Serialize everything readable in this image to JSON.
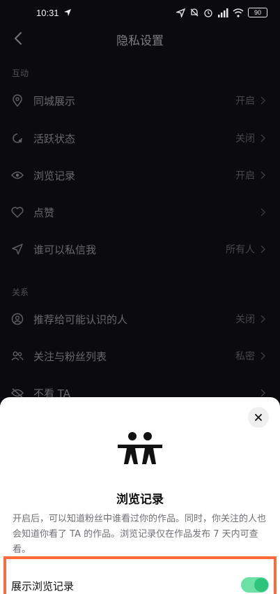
{
  "status_bar": {
    "time": "10:31",
    "battery": "90"
  },
  "nav": {
    "title": "隐私设置"
  },
  "sections": [
    {
      "label": "互动"
    },
    {
      "label": "关系"
    }
  ],
  "rows": [
    {
      "label": "同城展示",
      "value": "开启",
      "icon": "location-pin-icon"
    },
    {
      "label": "活跃状态",
      "value": "关闭",
      "icon": "activity-status-icon"
    },
    {
      "label": "浏览记录",
      "value": "开启",
      "icon": "eye-icon"
    },
    {
      "label": "点赞",
      "value": "",
      "icon": "heart-icon"
    },
    {
      "label": "谁可以私信我",
      "value": "所有人",
      "icon": "send-icon"
    },
    {
      "label": "推荐给可能认识的人",
      "value": "关闭",
      "icon": "person-circle-icon"
    },
    {
      "label": "关注与粉丝列表",
      "value": "私密",
      "icon": "two-persons-icon"
    },
    {
      "label": "不看 TA",
      "value": "",
      "icon": "eye-slash-icon"
    }
  ],
  "sheet": {
    "title": "浏览记录",
    "description": "开启后，可以知道粉丝中谁看过你的作品。同时，你关注的人也会知道你看了 TA 的作品。浏览记录仅在作品发布 7 天内可查看。",
    "toggle_label": "展示浏览记录",
    "toggle_on": true
  },
  "colors": {
    "accent_green": "#2fc47b",
    "highlight_orange": "#ff6a3d"
  }
}
